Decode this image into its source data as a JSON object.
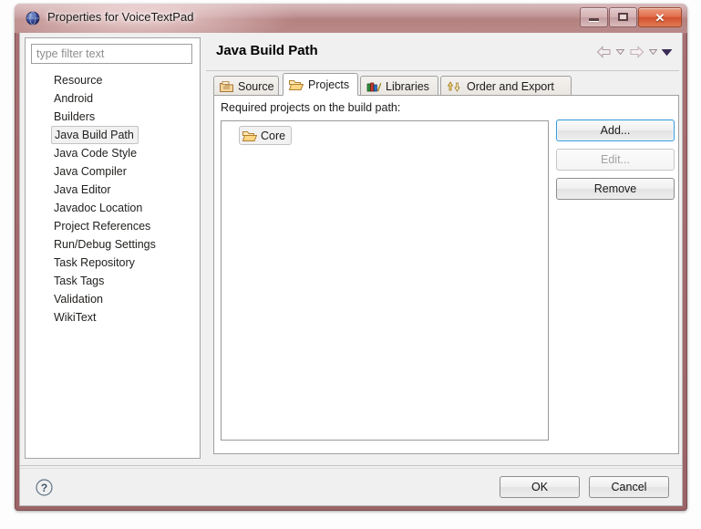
{
  "window": {
    "title": "Properties for VoiceTextPad",
    "app_icon": "eclipse-sphere-icon",
    "controls": {
      "minimize": "minimize-icon",
      "maximize": "maximize-icon",
      "close": "✕"
    }
  },
  "sidebar": {
    "filter": {
      "placeholder": "type filter text",
      "value": ""
    },
    "items": [
      {
        "label": "Resource",
        "selected": false
      },
      {
        "label": "Android",
        "selected": false
      },
      {
        "label": "Builders",
        "selected": false
      },
      {
        "label": "Java Build Path",
        "selected": true
      },
      {
        "label": "Java Code Style",
        "selected": false
      },
      {
        "label": "Java Compiler",
        "selected": false
      },
      {
        "label": "Java Editor",
        "selected": false
      },
      {
        "label": "Javadoc Location",
        "selected": false
      },
      {
        "label": "Project References",
        "selected": false
      },
      {
        "label": "Run/Debug Settings",
        "selected": false
      },
      {
        "label": "Task Repository",
        "selected": false
      },
      {
        "label": "Task Tags",
        "selected": false
      },
      {
        "label": "Validation",
        "selected": false
      },
      {
        "label": "WikiText",
        "selected": false
      }
    ]
  },
  "content": {
    "page_title": "Java Build Path",
    "nav": {
      "back": "back-arrow-icon",
      "back_menu": "chevron-down-icon",
      "forward": "forward-arrow-icon",
      "forward_menu": "chevron-down-icon",
      "view_menu": "view-menu-icon"
    },
    "tabs": [
      {
        "label": "Source",
        "icon": "source-folder-icon",
        "selected": false
      },
      {
        "label": "Projects",
        "icon": "open-folder-icon",
        "selected": true
      },
      {
        "label": "Libraries",
        "icon": "books-icon",
        "selected": false
      },
      {
        "label": "Order and Export",
        "icon": "order-arrows-icon",
        "selected": false
      }
    ],
    "projects_tab": {
      "required_label": "Required projects on the build path:",
      "tree_items": [
        {
          "label": "Core",
          "icon": "open-folder-icon",
          "selected": true
        }
      ],
      "buttons": [
        {
          "label": "Add...",
          "state": "focused"
        },
        {
          "label": "Edit...",
          "state": "disabled"
        },
        {
          "label": "Remove",
          "state": "normal"
        }
      ]
    }
  },
  "footer": {
    "help": "help-icon",
    "ok_label": "OK",
    "cancel_label": "Cancel"
  },
  "colors": {
    "titlebar": "#bd8c8e",
    "window_border": "#9c6467",
    "close_button": "#d3522c",
    "focus_blue": "#3c9cd8",
    "panel_bg": "#f0f0f0"
  }
}
